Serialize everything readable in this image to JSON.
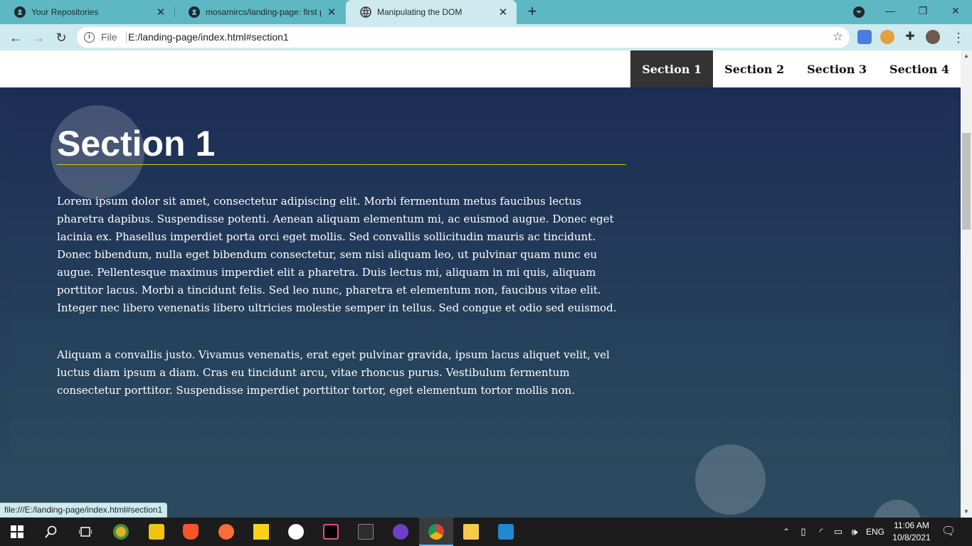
{
  "browser": {
    "tabs": [
      {
        "title": "Your Repositories",
        "active": false,
        "icon": "github-icon"
      },
      {
        "title": "mosamircs/landing-page: first project",
        "active": false,
        "icon": "github-icon"
      },
      {
        "title": "Manipulating the DOM",
        "active": true,
        "icon": "globe-icon"
      }
    ],
    "address": {
      "scheme_label": "File",
      "url": "E:/landing-page/index.html#section1"
    },
    "status_url": "file:///E:/landing-page/index.html#section1",
    "accent_color": "#5eb8c4"
  },
  "page": {
    "nav": [
      {
        "label": "Section 1",
        "active": true
      },
      {
        "label": "Section 2",
        "active": false
      },
      {
        "label": "Section 3",
        "active": false
      },
      {
        "label": "Section 4",
        "active": false
      }
    ],
    "section": {
      "title": "Section 1",
      "paragraphs": [
        "Lorem ipsum dolor sit amet, consectetur adipiscing elit. Morbi fermentum metus faucibus lectus pharetra dapibus. Suspendisse potenti. Aenean aliquam elementum mi, ac euismod augue. Donec eget lacinia ex. Phasellus imperdiet porta orci eget mollis. Sed convallis sollicitudin mauris ac tincidunt. Donec bibendum, nulla eget bibendum consectetur, sem nisi aliquam leo, ut pulvinar quam nunc eu augue. Pellentesque maximus imperdiet elit a pharetra. Duis lectus mi, aliquam in mi quis, aliquam porttitor lacus. Morbi a tincidunt felis. Sed leo nunc, pharetra et elementum non, faucibus vitae elit. Integer nec libero venenatis libero ultricies molestie semper in tellus. Sed congue et odio sed euismod.",
        "Aliquam a convallis justo. Vivamus venenatis, erat eget pulvinar gravida, ipsum lacus aliquet velit, vel luctus diam ipsum a diam. Cras eu tincidunt arcu, vitae rhoncus purus. Vestibulum fermentum consectetur porttitor. Suspendisse imperdiet porttitor tortor, eget elementum tortor mollis non."
      ]
    }
  },
  "taskbar": {
    "language": "ENG",
    "time": "11:06 AM",
    "date": "10/8/2021",
    "apps": [
      "windows-start",
      "search",
      "task-view",
      "chrome-canary",
      "pdf",
      "brave",
      "postman",
      "sticky-notes",
      "notion",
      "intellij",
      "terminal",
      "github-desktop",
      "chrome",
      "file-explorer",
      "vscode"
    ]
  }
}
